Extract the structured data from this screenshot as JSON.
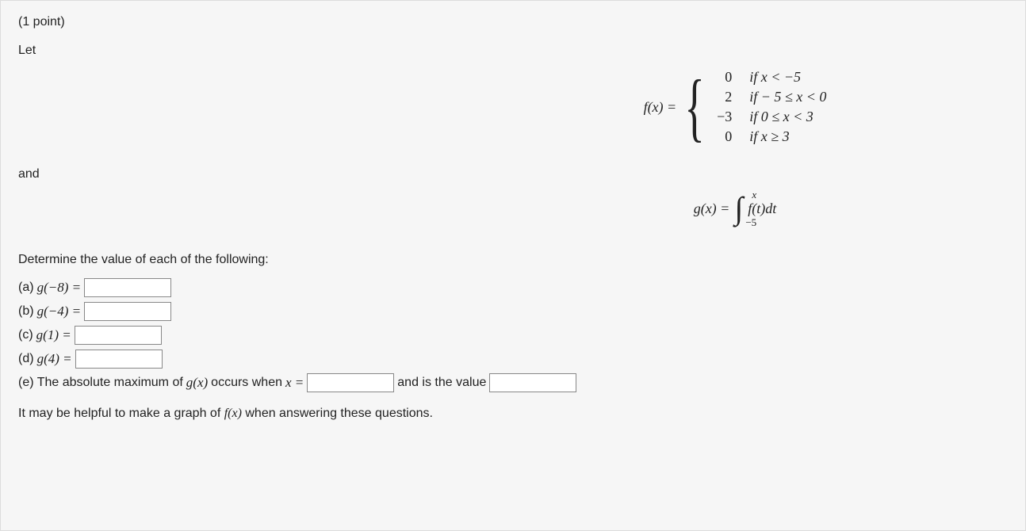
{
  "points": "(1 point)",
  "intro_let": "Let",
  "fx_label": "f(x) = ",
  "piecewise": {
    "rows": [
      {
        "val": "0",
        "cond": "if x < −5"
      },
      {
        "val": "2",
        "cond": "if − 5 ≤ x < 0"
      },
      {
        "val": "−3",
        "cond": "if 0 ≤ x < 3"
      },
      {
        "val": "0",
        "cond": "if x ≥ 3"
      }
    ]
  },
  "and_text": "and",
  "gx_lhs": "g(x) = ",
  "integral": {
    "upper": "x",
    "lower": "−5",
    "integrand": "f(t)dt"
  },
  "determine": "Determine the value of each of the following:",
  "parts": {
    "a": {
      "label": "(a) ",
      "expr": "g(−8) = "
    },
    "b": {
      "label": "(b) ",
      "expr": "g(−4) = "
    },
    "c": {
      "label": "(c) ",
      "expr": "g(1) = "
    },
    "d": {
      "label": "(d) ",
      "expr": "g(4) = "
    },
    "e": {
      "pre": "(e) The absolute maximum of ",
      "gx": "g(x)",
      "mid": " occurs when ",
      "xeq": "x = ",
      "post": " and is the value "
    }
  },
  "hint_pre": "It may be helpful to make a graph of ",
  "hint_fx": "f(x)",
  "hint_post": " when answering these questions."
}
